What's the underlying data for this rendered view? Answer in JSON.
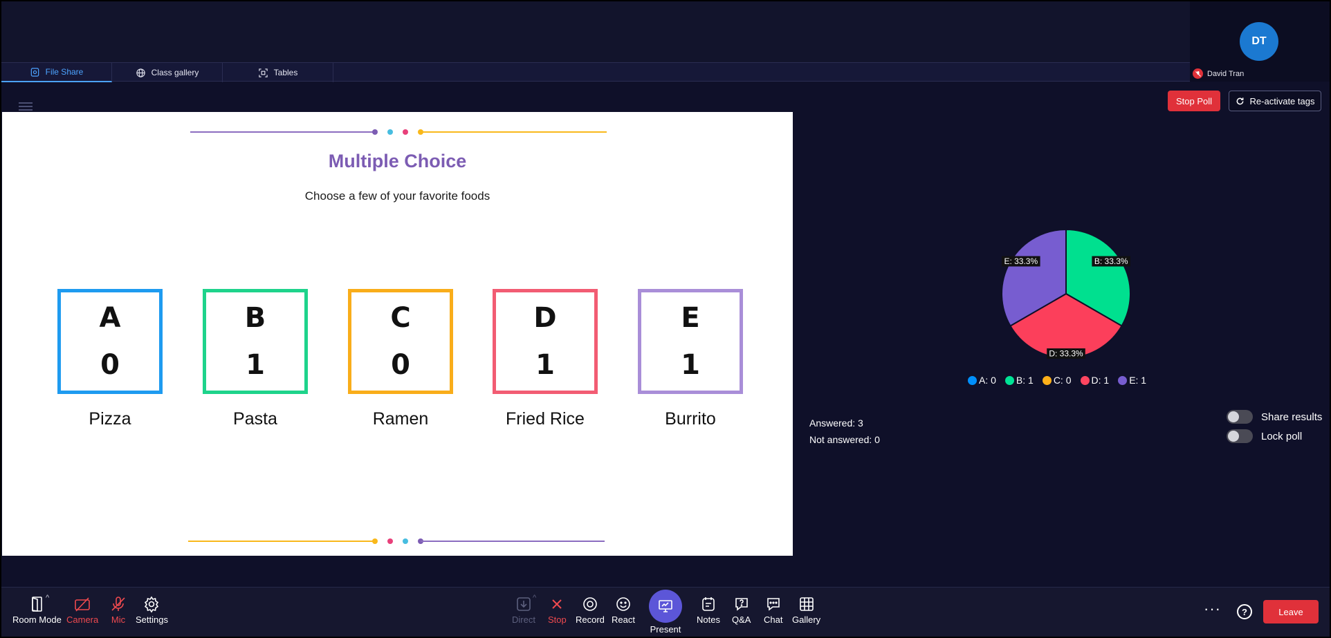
{
  "tabs": [
    {
      "label": "File Share",
      "icon": "file-share-icon",
      "active": true
    },
    {
      "label": "Class gallery",
      "icon": "globe-icon",
      "active": false
    },
    {
      "label": "Tables",
      "icon": "tables-icon",
      "active": false
    }
  ],
  "participant": {
    "initials": "DT",
    "name": "David Tran",
    "avatar_color": "#1b79d1",
    "mic_muted": true
  },
  "slide": {
    "title": "Multiple Choice",
    "subtitle": "Choose a few of your favorite foods",
    "options": [
      {
        "letter": "A",
        "count": "0",
        "name": "Pizza",
        "color": "#1e9bf0"
      },
      {
        "letter": "B",
        "count": "1",
        "name": "Pasta",
        "color": "#1ed38b"
      },
      {
        "letter": "C",
        "count": "0",
        "name": "Ramen",
        "color": "#f9ad1a"
      },
      {
        "letter": "D",
        "count": "1",
        "name": "Fried Rice",
        "color": "#f25c73"
      },
      {
        "letter": "E",
        "count": "1",
        "name": "Burrito",
        "color": "#a98ed8"
      }
    ]
  },
  "poll": {
    "stop_label": "Stop Poll",
    "reactivate_label": "Re-activate tags",
    "answered": "Answered: 3",
    "not_answered": "Not answered: 0",
    "share_results_label": "Share results",
    "lock_poll_label": "Lock poll",
    "share_results_on": false,
    "lock_poll_on": false
  },
  "chart_data": {
    "type": "pie",
    "slices": [
      {
        "label": "B",
        "value": 1,
        "percent_label": "B: 33.3%",
        "color": "#00e08f"
      },
      {
        "label": "D",
        "value": 1,
        "percent_label": "D: 33.3%",
        "color": "#fc3f5b"
      },
      {
        "label": "E",
        "value": 1,
        "percent_label": "E: 33.3%",
        "color": "#775dd0"
      }
    ],
    "legend": [
      {
        "label": "A: 0",
        "color": "#008ffb"
      },
      {
        "label": "B: 1",
        "color": "#00e396"
      },
      {
        "label": "C: 0",
        "color": "#feb019"
      },
      {
        "label": "D: 1",
        "color": "#ff4560"
      },
      {
        "label": "E: 1",
        "color": "#775dd0"
      }
    ],
    "legend_position": "bottom"
  },
  "toolbar": {
    "room_mode": "Room Mode",
    "camera": "Camera",
    "mic": "Mic",
    "settings": "Settings",
    "direct": "Direct",
    "stop": "Stop",
    "record": "Record",
    "react": "React",
    "present": "Present",
    "notes": "Notes",
    "qa": "Q&A",
    "chat": "Chat",
    "gallery": "Gallery",
    "help": "?",
    "leave": "Leave"
  }
}
